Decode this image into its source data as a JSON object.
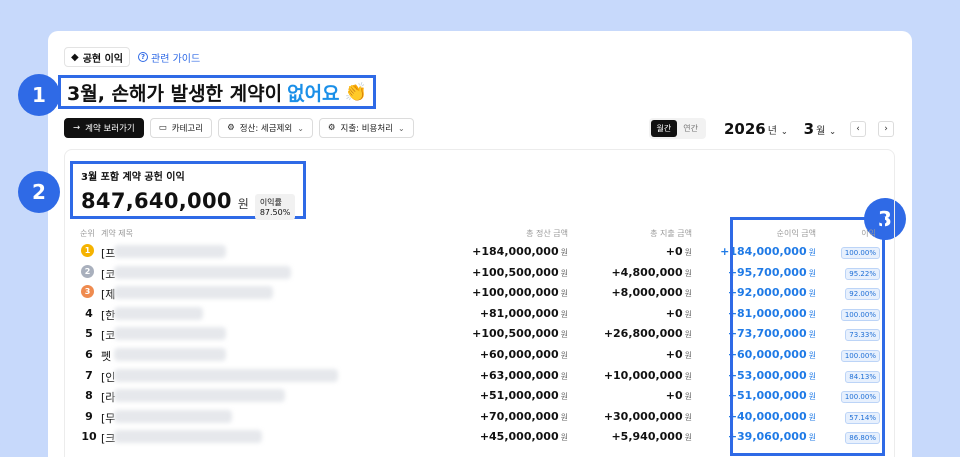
{
  "header": {
    "chip_label": "공현 이익",
    "guide_link": "관련 가이드",
    "headline_main": "3월, 손해가 발생한 계약이",
    "headline_accent": "없어요",
    "headline_emoji": "👏"
  },
  "callouts": [
    "1",
    "2",
    "3"
  ],
  "toolbar": {
    "view_contracts": "계약 보러가기",
    "category": "카테고리",
    "settlement_filter": "정산: 세금제외",
    "expense_filter": "지출: 비용처리"
  },
  "period": {
    "monthly": "월간",
    "yearly": "연간",
    "year": "2026",
    "year_unit": "년",
    "month": "3",
    "month_unit": "월",
    "prev": "‹",
    "next": "›"
  },
  "summary": {
    "title": "3월 포함 계약 공헌 이익",
    "amount": "847,640,000",
    "unit": "원",
    "rate_label": "이익률 87.50%"
  },
  "table": {
    "headers": {
      "rank": "순위",
      "title": "계약 제목",
      "total_settlement": "총 정산 금액",
      "total_expense": "총 지출 금액",
      "net_profit": "순이익 금액",
      "rate": "이익"
    },
    "won": "원",
    "rows": [
      {
        "rank": "1",
        "medal": "gold",
        "prefix": "[프",
        "settlement": "+184,000,000",
        "expense": "+0",
        "net": "+184,000,000",
        "rate": "100.00%",
        "blur_fraction": 0.95
      },
      {
        "rank": "2",
        "medal": "silver",
        "prefix": "[코",
        "settlement": "+100,500,000",
        "expense": "+4,800,000",
        "net": "+95,700,000",
        "rate": "95.22%",
        "blur_fraction": 1.5
      },
      {
        "rank": "3",
        "medal": "bronze",
        "prefix": "[제",
        "settlement": "+100,000,000",
        "expense": "+8,000,000",
        "net": "+92,000,000",
        "rate": "92.00%",
        "blur_fraction": 1.35
      },
      {
        "rank": "4",
        "medal": "",
        "prefix": "[한",
        "settlement": "+81,000,000",
        "expense": "+0",
        "net": "+81,000,000",
        "rate": "100.00%",
        "blur_fraction": 0.75
      },
      {
        "rank": "5",
        "medal": "",
        "prefix": "[코",
        "settlement": "+100,500,000",
        "expense": "+26,800,000",
        "net": "+73,700,000",
        "rate": "73.33%",
        "blur_fraction": 0.95
      },
      {
        "rank": "6",
        "medal": "",
        "prefix": "펫",
        "settlement": "+60,000,000",
        "expense": "+0",
        "net": "+60,000,000",
        "rate": "100.00%",
        "blur_fraction": 0.95
      },
      {
        "rank": "7",
        "medal": "",
        "prefix": "[인",
        "settlement": "+63,000,000",
        "expense": "+10,000,000",
        "net": "+53,000,000",
        "rate": "84.13%",
        "blur_fraction": 1.9
      },
      {
        "rank": "8",
        "medal": "",
        "prefix": "[라",
        "settlement": "+51,000,000",
        "expense": "+0",
        "net": "+51,000,000",
        "rate": "100.00%",
        "blur_fraction": 1.45
      },
      {
        "rank": "9",
        "medal": "",
        "prefix": "[무",
        "settlement": "+70,000,000",
        "expense": "+30,000,000",
        "net": "+40,000,000",
        "rate": "57.14%",
        "blur_fraction": 1.0
      },
      {
        "rank": "10",
        "medal": "",
        "prefix": "[크",
        "settlement": "+45,000,000",
        "expense": "+5,940,000",
        "net": "+39,060,000",
        "rate": "86.80%",
        "blur_fraction": 1.25
      }
    ]
  }
}
